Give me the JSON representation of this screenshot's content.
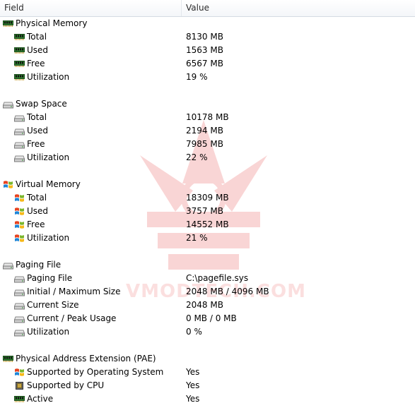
{
  "header": {
    "field": "Field",
    "value": "Value"
  },
  "watermark": "VMODTECH.COM",
  "rows": [
    {
      "kind": "group",
      "icon": "memory-icon",
      "name": "physical-memory-group",
      "label": "Physical Memory",
      "value": ""
    },
    {
      "kind": "item",
      "icon": "memory-icon",
      "name": "physical-memory-total",
      "label": "Total",
      "value": "8130 MB"
    },
    {
      "kind": "item",
      "icon": "memory-icon",
      "name": "physical-memory-used",
      "label": "Used",
      "value": "1563 MB"
    },
    {
      "kind": "item",
      "icon": "memory-icon",
      "name": "physical-memory-free",
      "label": "Free",
      "value": "6567 MB"
    },
    {
      "kind": "item",
      "icon": "memory-icon",
      "name": "physical-memory-utilization",
      "label": "Utilization",
      "value": "19 %"
    },
    {
      "kind": "spacer"
    },
    {
      "kind": "group",
      "icon": "drive-icon",
      "name": "swap-space-group",
      "label": "Swap Space",
      "value": ""
    },
    {
      "kind": "item",
      "icon": "drive-icon",
      "name": "swap-space-total",
      "label": "Total",
      "value": "10178 MB"
    },
    {
      "kind": "item",
      "icon": "drive-icon",
      "name": "swap-space-used",
      "label": "Used",
      "value": "2194 MB"
    },
    {
      "kind": "item",
      "icon": "drive-icon",
      "name": "swap-space-free",
      "label": "Free",
      "value": "7985 MB"
    },
    {
      "kind": "item",
      "icon": "drive-icon",
      "name": "swap-space-utilization",
      "label": "Utilization",
      "value": "22 %"
    },
    {
      "kind": "spacer"
    },
    {
      "kind": "group",
      "icon": "windows-flag-icon",
      "name": "virtual-memory-group",
      "label": "Virtual Memory",
      "value": ""
    },
    {
      "kind": "item",
      "icon": "windows-flag-icon",
      "name": "virtual-memory-total",
      "label": "Total",
      "value": "18309 MB"
    },
    {
      "kind": "item",
      "icon": "windows-flag-icon",
      "name": "virtual-memory-used",
      "label": "Used",
      "value": "3757 MB"
    },
    {
      "kind": "item",
      "icon": "windows-flag-icon",
      "name": "virtual-memory-free",
      "label": "Free",
      "value": "14552 MB"
    },
    {
      "kind": "item",
      "icon": "windows-flag-icon",
      "name": "virtual-memory-utilization",
      "label": "Utilization",
      "value": "21 %"
    },
    {
      "kind": "spacer"
    },
    {
      "kind": "group",
      "icon": "drive-icon",
      "name": "paging-file-group",
      "label": "Paging File",
      "value": ""
    },
    {
      "kind": "item",
      "icon": "drive-icon",
      "name": "paging-file-path",
      "label": "Paging File",
      "value": "C:\\pagefile.sys"
    },
    {
      "kind": "item",
      "icon": "drive-icon",
      "name": "paging-file-initial-max",
      "label": "Initial / Maximum Size",
      "value": "2048 MB / 4096 MB"
    },
    {
      "kind": "item",
      "icon": "drive-icon",
      "name": "paging-file-current-size",
      "label": "Current Size",
      "value": "2048 MB"
    },
    {
      "kind": "item",
      "icon": "drive-icon",
      "name": "paging-file-current-peak",
      "label": "Current / Peak Usage",
      "value": "0 MB / 0 MB"
    },
    {
      "kind": "item",
      "icon": "drive-icon",
      "name": "paging-file-utilization",
      "label": "Utilization",
      "value": "0 %"
    },
    {
      "kind": "spacer"
    },
    {
      "kind": "group",
      "icon": "memory-icon",
      "name": "pae-group",
      "label": "Physical Address Extension (PAE)",
      "value": ""
    },
    {
      "kind": "item",
      "icon": "windows-flag-icon",
      "name": "pae-supported-os",
      "label": "Supported by Operating System",
      "value": "Yes"
    },
    {
      "kind": "item",
      "icon": "cpu-icon",
      "name": "pae-supported-cpu",
      "label": "Supported by CPU",
      "value": "Yes"
    },
    {
      "kind": "item",
      "icon": "memory-icon",
      "name": "pae-active",
      "label": "Active",
      "value": "Yes"
    }
  ]
}
